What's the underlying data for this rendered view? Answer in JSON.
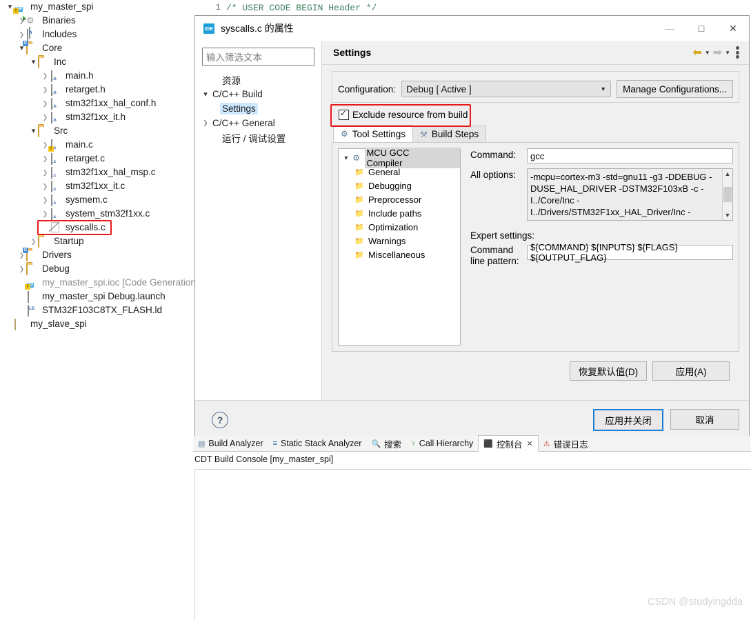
{
  "editor": {
    "line_number": "1",
    "code": "/* USER CODE BEGIN Header */"
  },
  "project_tree": {
    "items": [
      {
        "label": "my_master_spi",
        "indent": 0,
        "arrow": "open",
        "icon": "ide-project-icon",
        "warn": true
      },
      {
        "label": "Binaries",
        "indent": 1,
        "arrow": "closed",
        "icon": "binaries-icon"
      },
      {
        "label": "Includes",
        "indent": 1,
        "arrow": "closed",
        "icon": "includes-icon"
      },
      {
        "label": "Core",
        "indent": 1,
        "arrow": "open",
        "icon": "source-folder-icon"
      },
      {
        "label": "Inc",
        "indent": 2,
        "arrow": "open",
        "icon": "folder-icon"
      },
      {
        "label": "main.h",
        "indent": 3,
        "arrow": "closed",
        "icon": "h-file-icon"
      },
      {
        "label": "retarget.h",
        "indent": 3,
        "arrow": "closed",
        "icon": "h-file-icon"
      },
      {
        "label": "stm32f1xx_hal_conf.h",
        "indent": 3,
        "arrow": "closed",
        "icon": "h-file-icon"
      },
      {
        "label": "stm32f1xx_it.h",
        "indent": 3,
        "arrow": "closed",
        "icon": "h-file-icon"
      },
      {
        "label": "Src",
        "indent": 2,
        "arrow": "open",
        "icon": "folder-icon"
      },
      {
        "label": "main.c",
        "indent": 3,
        "arrow": "closed",
        "icon": "c-file-icon",
        "warn": true
      },
      {
        "label": "retarget.c",
        "indent": 3,
        "arrow": "closed",
        "icon": "c-file-icon"
      },
      {
        "label": "stm32f1xx_hal_msp.c",
        "indent": 3,
        "arrow": "closed",
        "icon": "c-file-icon"
      },
      {
        "label": "stm32f1xx_it.c",
        "indent": 3,
        "arrow": "closed",
        "icon": "c-file-icon"
      },
      {
        "label": "sysmem.c",
        "indent": 3,
        "arrow": "closed",
        "icon": "c-file-icon"
      },
      {
        "label": "system_stm32f1xx.c",
        "indent": 3,
        "arrow": "closed",
        "icon": "c-file-icon"
      },
      {
        "label": "syscalls.c",
        "indent": 3,
        "arrow": "none",
        "icon": "excluded-file-icon",
        "selected": true
      },
      {
        "label": "Startup",
        "indent": 2,
        "arrow": "closed",
        "icon": "folder-icon"
      },
      {
        "label": "Drivers",
        "indent": 1,
        "arrow": "closed",
        "icon": "source-folder-icon"
      },
      {
        "label": "Debug",
        "indent": 1,
        "arrow": "closed",
        "icon": "folder-icon"
      },
      {
        "label": "my_master_spi.ioc [Code Generation is",
        "indent": 1,
        "arrow": "none",
        "icon": "cubemx-icon",
        "dim": true,
        "warn": true
      },
      {
        "label": "my_master_spi Debug.launch",
        "indent": 1,
        "arrow": "none",
        "icon": "launch-file-icon"
      },
      {
        "label": "STM32F103C8TX_FLASH.ld",
        "indent": 1,
        "arrow": "none",
        "icon": "ld-file-icon"
      },
      {
        "label": "my_slave_spi",
        "indent": 0,
        "arrow": "none",
        "icon": "closed-project-icon"
      }
    ]
  },
  "dialog": {
    "title": "syscalls.c 的属性",
    "window_buttons": {
      "minimize": "—",
      "maximize": "□",
      "close": "✕"
    },
    "nav": {
      "filter_placeholder": "输入筛选文本",
      "items": [
        {
          "label": "资源",
          "arrow": "none",
          "indent": 1
        },
        {
          "label": "C/C++ Build",
          "arrow": "open",
          "indent": 0
        },
        {
          "label": "Settings",
          "arrow": "none",
          "indent": 1,
          "selected": true
        },
        {
          "label": "C/C++ General",
          "arrow": "closed",
          "indent": 0
        },
        {
          "label": "运行 / 调试设置",
          "arrow": "none",
          "indent": 1
        }
      ]
    },
    "content": {
      "heading": "Settings",
      "toolbar": {
        "back_icon": "back-arrow-icon",
        "forward_icon": "forward-arrow-icon",
        "menu_icon": "view-menu-icon"
      },
      "configuration_label": "Configuration:",
      "configuration_value": "Debug  [ Active ]",
      "manage_configurations_label": "Manage Configurations...",
      "exclude_label": "Exclude resource from build",
      "exclude_checked": true,
      "highlight_color": "#e8191b",
      "tabs": [
        {
          "label": "Tool Settings",
          "icon": "tool-settings-icon",
          "active": true
        },
        {
          "label": "Build Steps",
          "icon": "build-steps-icon",
          "active": false
        }
      ],
      "tool_tree": [
        {
          "label": "MCU GCC Compiler",
          "level": 0,
          "selected": true,
          "icon": "compiler-icon"
        },
        {
          "label": "General",
          "level": 1,
          "icon": "settings-folder-icon"
        },
        {
          "label": "Debugging",
          "level": 1,
          "icon": "settings-folder-icon"
        },
        {
          "label": "Preprocessor",
          "level": 1,
          "icon": "settings-folder-icon"
        },
        {
          "label": "Include paths",
          "level": 1,
          "icon": "settings-folder-icon"
        },
        {
          "label": "Optimization",
          "level": 1,
          "icon": "settings-folder-icon"
        },
        {
          "label": "Warnings",
          "level": 1,
          "icon": "settings-folder-icon"
        },
        {
          "label": "Miscellaneous",
          "level": 1,
          "icon": "settings-folder-icon"
        }
      ],
      "command_label": "Command:",
      "command_value": "gcc",
      "all_options_label": "All options:",
      "all_options_value": "-mcpu=cortex-m3 -std=gnu11 -g3 -DDEBUG -DUSE_HAL_DRIVER -DSTM32F103xB -c -I../Core/Inc -I../Drivers/STM32F1xx_HAL_Driver/Inc -",
      "expert_settings_label": "Expert settings:",
      "command_line_pattern_label_1": "Command",
      "command_line_pattern_label_2": "line pattern:",
      "command_line_pattern_value": "${COMMAND} ${INPUTS} ${FLAGS} ${OUTPUT_FLAG}",
      "restore_defaults_label": "恢复默认值(D)",
      "apply_label": "应用(A)"
    },
    "footer": {
      "help_icon": "help-icon",
      "apply_and_close_label": "应用并关闭",
      "cancel_label": "取消"
    }
  },
  "bottom_views": {
    "tabs": [
      {
        "label": "Build Analyzer",
        "icon": "build-analyzer-icon",
        "active": false,
        "closeable": false
      },
      {
        "label": "Static Stack Analyzer",
        "icon": "static-stack-analyzer-icon",
        "active": false,
        "closeable": false
      },
      {
        "label": "搜索",
        "icon": "search-icon",
        "active": false,
        "closeable": false
      },
      {
        "label": "Call Hierarchy",
        "icon": "call-hierarchy-icon",
        "active": false,
        "closeable": false
      },
      {
        "label": "控制台",
        "icon": "console-icon",
        "active": true,
        "closeable": true
      },
      {
        "label": "错误日志",
        "icon": "error-log-icon",
        "active": false,
        "closeable": false
      }
    ],
    "console_label": "CDT Build Console [my_master_spi]"
  },
  "watermark": "CSDN @studyingdda"
}
